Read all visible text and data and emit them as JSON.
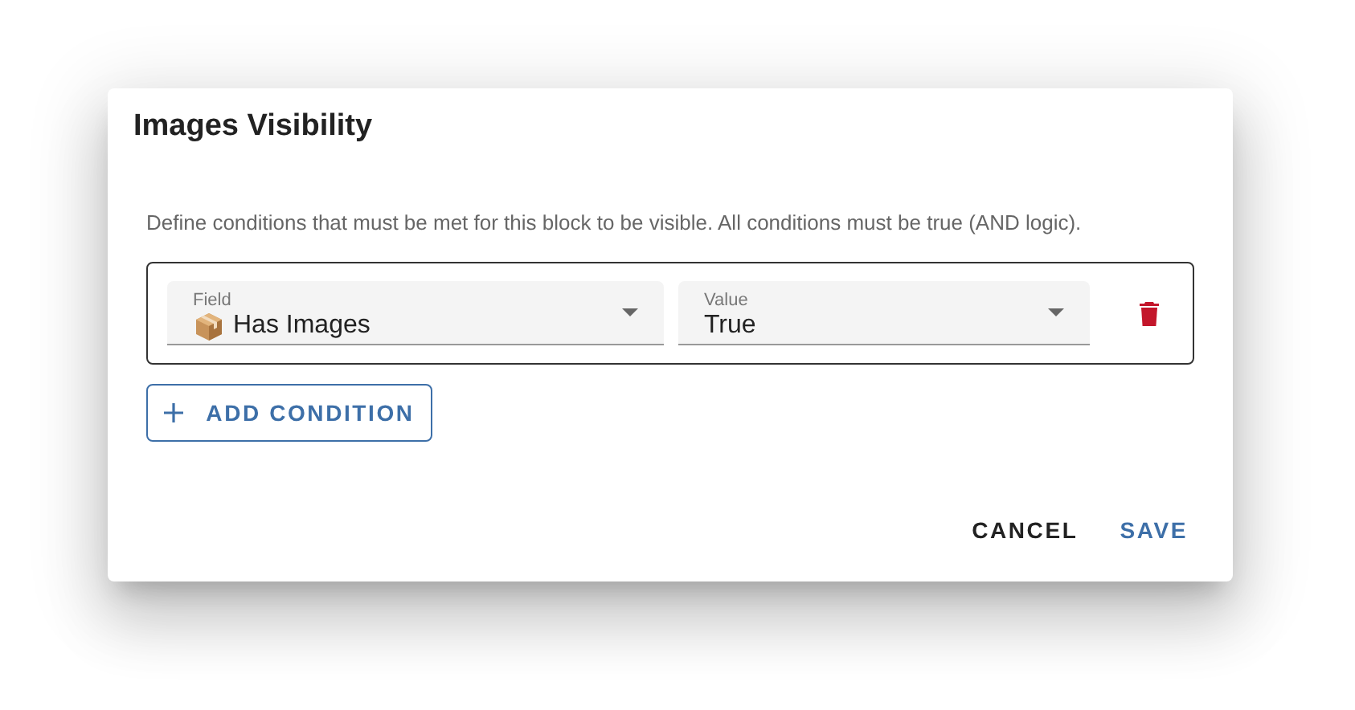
{
  "dialog": {
    "title": "Images Visibility",
    "description": "Define conditions that must be met for this block to be visible. All conditions must be true (AND logic).",
    "conditions": [
      {
        "field": {
          "label": "Field",
          "value": "Has Images"
        },
        "value": {
          "label": "Value",
          "value": "True"
        }
      }
    ],
    "add_button": "ADD CONDITION",
    "actions": [
      {
        "label": "CANCEL",
        "kind": "neutral"
      },
      {
        "label": "SAVE",
        "kind": "primary"
      }
    ]
  }
}
